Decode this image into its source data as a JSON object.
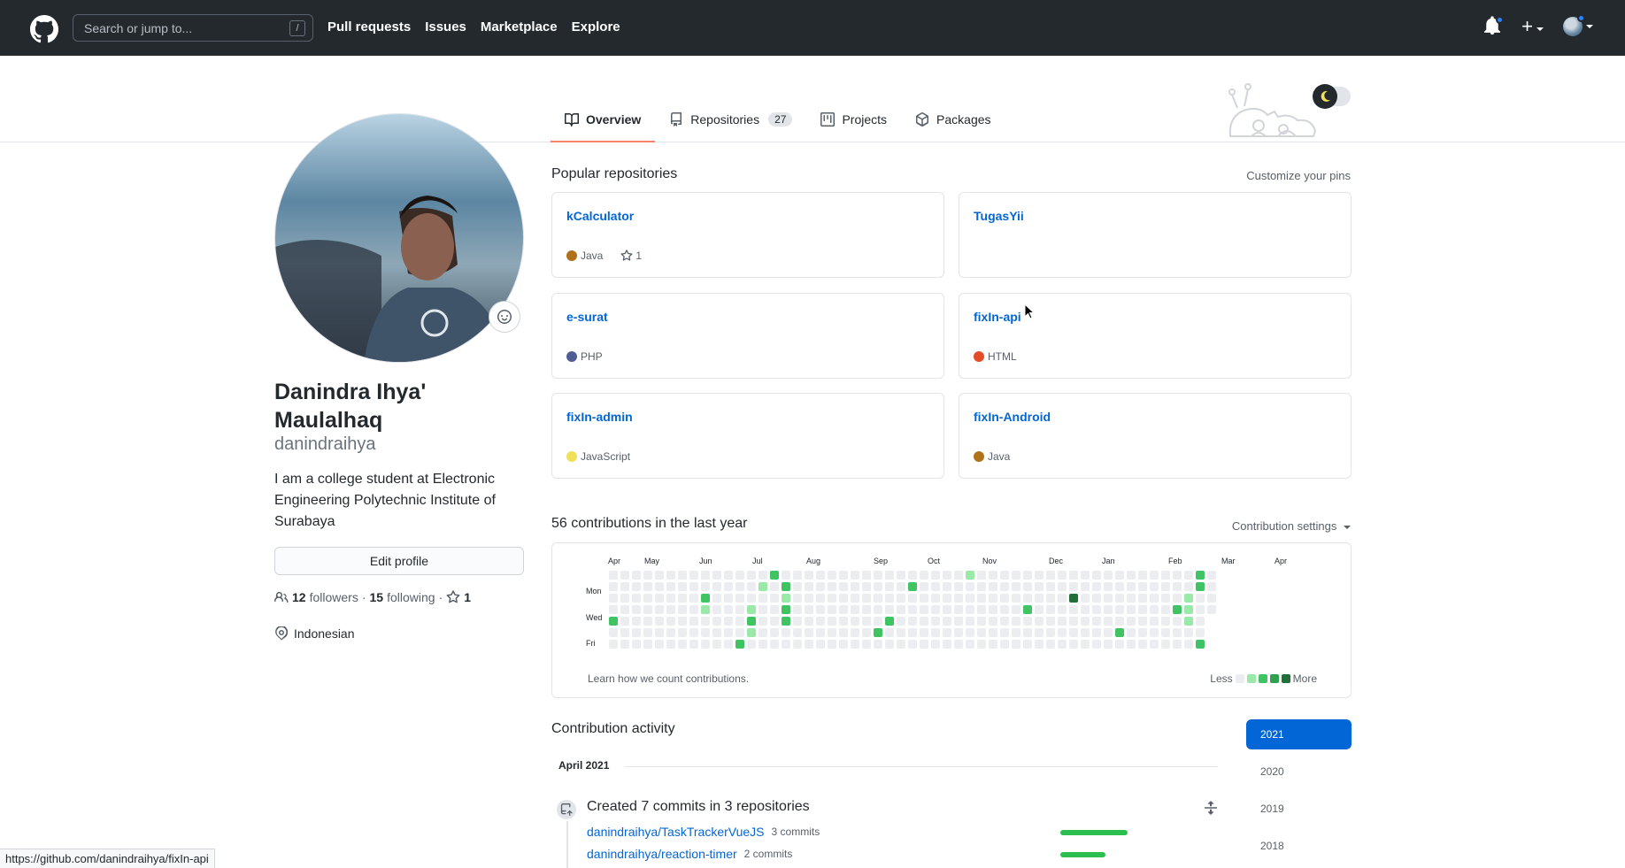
{
  "header": {
    "search_placeholder": "Search or jump to...",
    "search_key": "/",
    "nav": [
      "Pull requests",
      "Issues",
      "Marketplace",
      "Explore"
    ]
  },
  "tabs": [
    {
      "label": "Overview",
      "icon": "book-icon",
      "active": true
    },
    {
      "label": "Repositories",
      "icon": "repo-icon",
      "count": "27"
    },
    {
      "label": "Projects",
      "icon": "project-icon"
    },
    {
      "label": "Packages",
      "icon": "package-icon"
    }
  ],
  "profile": {
    "full_name": "Danindra Ihya' Maulalhaq",
    "username": "danindraihya",
    "bio": "I am a college student at Electronic Engineering Polytechnic Institute of Surabaya",
    "edit_label": "Edit profile",
    "followers_count": "12",
    "followers_label": "followers",
    "following_count": "15",
    "following_label": "following",
    "stars_count": "1",
    "location": "Indonesian"
  },
  "popular": {
    "title": "Popular repositories",
    "customize": "Customize your pins",
    "pins": [
      {
        "name": "kCalculator",
        "lang": "Java",
        "color": "#b07219",
        "stars": "1"
      },
      {
        "name": "TugasYii",
        "lang": "",
        "color": ""
      },
      {
        "name": "e-surat",
        "lang": "PHP",
        "color": "#4F5D95"
      },
      {
        "name": "fixIn-api",
        "lang": "HTML",
        "color": "#e34c26"
      },
      {
        "name": "fixIn-admin",
        "lang": "JavaScript",
        "color": "#f1e05a"
      },
      {
        "name": "fixIn-Android",
        "lang": "Java",
        "color": "#b07219"
      }
    ]
  },
  "contributions": {
    "title": "56 contributions in the last year",
    "settings": "Contribution settings",
    "months": [
      "Apr",
      "May",
      "Jun",
      "Jul",
      "Aug",
      "Sep",
      "Oct",
      "Nov",
      "Dec",
      "Jan",
      "Feb",
      "Mar",
      "Apr"
    ],
    "days": [
      "Mon",
      "Wed",
      "Fri"
    ],
    "learn": "Learn how we count contributions.",
    "less": "Less",
    "more": "More",
    "level_colors": [
      "#ebedf0",
      "#9be9a8",
      "#40c463",
      "#30a14e",
      "#216e39"
    ]
  },
  "activity": {
    "title": "Contribution activity",
    "month": "April 2021",
    "summary": "Created 7 commits in 3 repositories",
    "repos": [
      {
        "name": "danindraihya/TaskTrackerVueJS",
        "commits": "3 commits"
      },
      {
        "name": "danindraihya/reaction-timer",
        "commits": "2 commits"
      }
    ],
    "years": [
      "2021",
      "2020",
      "2019",
      "2018"
    ]
  },
  "status_url": "https://github.com/danindraihya/fixIn-api"
}
